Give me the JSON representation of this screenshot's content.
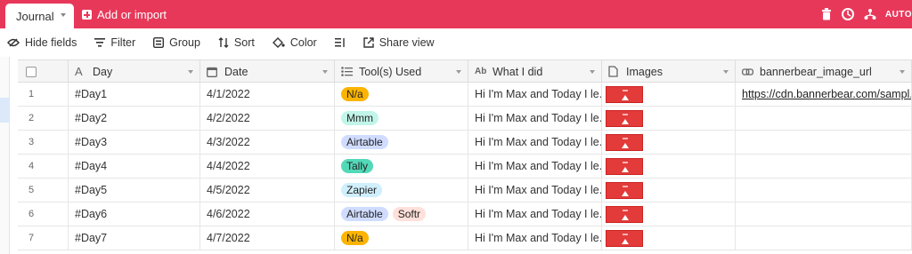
{
  "tabs": {
    "active_label": "Journal",
    "add_label": "Add or import"
  },
  "top_right": {
    "automations_label": "AUTO"
  },
  "toolbar": {
    "hide_fields": "Hide fields",
    "filter": "Filter",
    "group": "Group",
    "sort": "Sort",
    "color": "Color",
    "share": "Share view"
  },
  "columns": {
    "day": "Day",
    "date": "Date",
    "tools": "Tool(s) Used",
    "what": "What I did",
    "images": "Images",
    "url": "bannerbear_image_url"
  },
  "colors": {
    "brand": "#e8385a",
    "pill_na": "#fcb400",
    "pill_mmm": "#c2f5e9",
    "pill_airtable": "#d0dcff",
    "pill_tally": "#53d9b8",
    "pill_zapier": "#cfeffd",
    "pill_softr": "#ffe0da"
  },
  "rows": [
    {
      "num": "1",
      "day": "#Day1",
      "date": "4/1/2022",
      "tools": [
        {
          "label": "N/a",
          "color": "#fcb400"
        }
      ],
      "what": "Hi I'm Max and Today I le...",
      "url": "https://cdn.bannerbear.com/sampl..."
    },
    {
      "num": "2",
      "day": "#Day2",
      "date": "4/2/2022",
      "tools": [
        {
          "label": "Mmm",
          "color": "#c2f5e9"
        }
      ],
      "what": "Hi I'm Max and Today I le...",
      "url": ""
    },
    {
      "num": "3",
      "day": "#Day3",
      "date": "4/3/2022",
      "tools": [
        {
          "label": "Airtable",
          "color": "#d0dcff"
        }
      ],
      "what": "Hi I'm Max and Today I le...",
      "url": ""
    },
    {
      "num": "4",
      "day": "#Day4",
      "date": "4/4/2022",
      "tools": [
        {
          "label": "Tally",
          "color": "#53d9b8"
        }
      ],
      "what": "Hi I'm Max and Today I le...",
      "url": ""
    },
    {
      "num": "5",
      "day": "#Day5",
      "date": "4/5/2022",
      "tools": [
        {
          "label": "Zapier",
          "color": "#cfeffd"
        }
      ],
      "what": "Hi I'm Max and Today I le...",
      "url": ""
    },
    {
      "num": "6",
      "day": "#Day6",
      "date": "4/6/2022",
      "tools": [
        {
          "label": "Airtable",
          "color": "#d0dcff"
        },
        {
          "label": "Softr",
          "color": "#ffe0da"
        }
      ],
      "what": "Hi I'm Max and Today I le...",
      "url": ""
    },
    {
      "num": "7",
      "day": "#Day7",
      "date": "4/7/2022",
      "tools": [
        {
          "label": "N/a",
          "color": "#fcb400"
        }
      ],
      "what": "Hi I'm Max and Today I le...",
      "url": ""
    }
  ]
}
